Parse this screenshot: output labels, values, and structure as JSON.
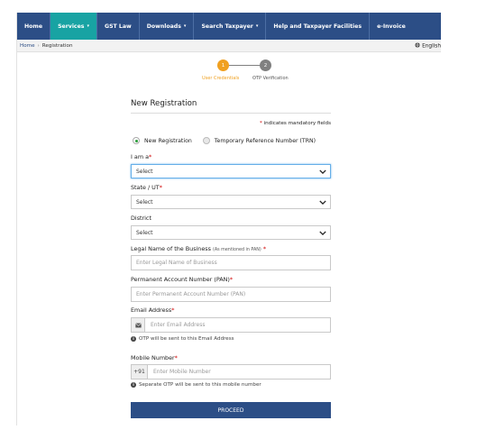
{
  "nav": {
    "items": [
      {
        "label": "Home",
        "active": false,
        "caret": false
      },
      {
        "label": "Services",
        "active": true,
        "caret": true
      },
      {
        "label": "GST Law",
        "active": false,
        "caret": false
      },
      {
        "label": "Downloads",
        "active": false,
        "caret": true
      },
      {
        "label": "Search Taxpayer",
        "active": false,
        "caret": true
      },
      {
        "label": "Help and Taxpayer Facilities",
        "active": false,
        "caret": false
      },
      {
        "label": "e-Invoice",
        "active": false,
        "caret": false
      }
    ],
    "caret_char": "▾"
  },
  "breadcrumb": {
    "home": "Home",
    "separator": "›",
    "current": "Registration"
  },
  "language": {
    "label": "English",
    "icon": "globe-icon"
  },
  "steps": {
    "step1": {
      "number": "1",
      "label": "User Credentials"
    },
    "step2": {
      "number": "2",
      "label": "OTP Verification"
    },
    "colors": {
      "active": "#f0a020",
      "inactive": "#808080"
    }
  },
  "form": {
    "title": "New Registration",
    "mandatory_star": "*",
    "mandatory_note": "indicates mandatory fields",
    "radio_new": "New Registration",
    "radio_trn": "Temporary Reference Number (TRN)",
    "radio_selected": "new",
    "i_am_a": {
      "label": "I am a",
      "value": "Select"
    },
    "state": {
      "label": "State / UT",
      "value": "Select"
    },
    "district": {
      "label": "District",
      "value": "Select"
    },
    "legal_name": {
      "label": "Legal Name of the Business",
      "hint": "(As mentioned in PAN)",
      "placeholder": "Enter Legal Name of Business"
    },
    "pan": {
      "label": "Permanent Account Number (PAN)",
      "placeholder": "Enter Permanent Account Number (PAN)"
    },
    "email": {
      "label": "Email Address",
      "placeholder": "Enter Email Address",
      "note": "OTP will be sent to this Email Address",
      "icon": "envelope-icon"
    },
    "mobile": {
      "label": "Mobile Number",
      "prefix": "+91",
      "placeholder": "Enter Mobile Number",
      "note": "Separate OTP will be sent to this mobile number"
    },
    "proceed": "PROCEED",
    "info_char": "i"
  },
  "colors": {
    "nav_bg": "#2c4e86",
    "nav_active": "#18a3a3",
    "required": "#d00000",
    "button": "#2c4e86"
  }
}
